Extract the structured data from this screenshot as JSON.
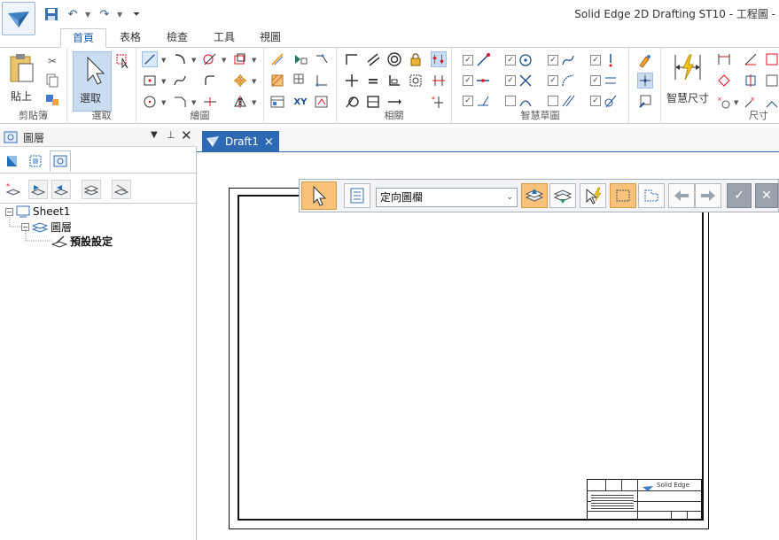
{
  "window": {
    "title": "Solid Edge 2D Drafting ST10 - 工程圖 -"
  },
  "quick_access": {
    "items": [
      "save-icon",
      "undo-icon",
      "redo-icon",
      "customize-icon"
    ]
  },
  "tabs": [
    {
      "label": "首頁",
      "active": true
    },
    {
      "label": "表格",
      "active": false
    },
    {
      "label": "檢查",
      "active": false
    },
    {
      "label": "工具",
      "active": false
    },
    {
      "label": "視圖",
      "active": false
    }
  ],
  "ribbon": {
    "groups": {
      "clipboard": {
        "label": "剪貼簿",
        "paste_label": "貼上"
      },
      "select": {
        "label": "選取",
        "select_label": "選取"
      },
      "draw": {
        "label": "繪圖"
      },
      "relate": {
        "label": "相關"
      },
      "intellisketch": {
        "label": "智慧草圖"
      },
      "dimension": {
        "label": "尺寸",
        "smart_dimension_label": "智慧尺寸"
      }
    }
  },
  "panel": {
    "title": "圖層",
    "tree": {
      "sheet": "Sheet1",
      "layers": "圖層",
      "default": "預設設定"
    }
  },
  "document": {
    "tab_label": "Draft1",
    "close_glyph": "×"
  },
  "command_bar": {
    "dropdown_value": "定向圖欄"
  },
  "title_block": {
    "company": "Solid Edge"
  },
  "colors": {
    "accent": "#2e6ab3",
    "select_highlight": "#c9dcf2",
    "orange_button": "#f9c27a"
  }
}
